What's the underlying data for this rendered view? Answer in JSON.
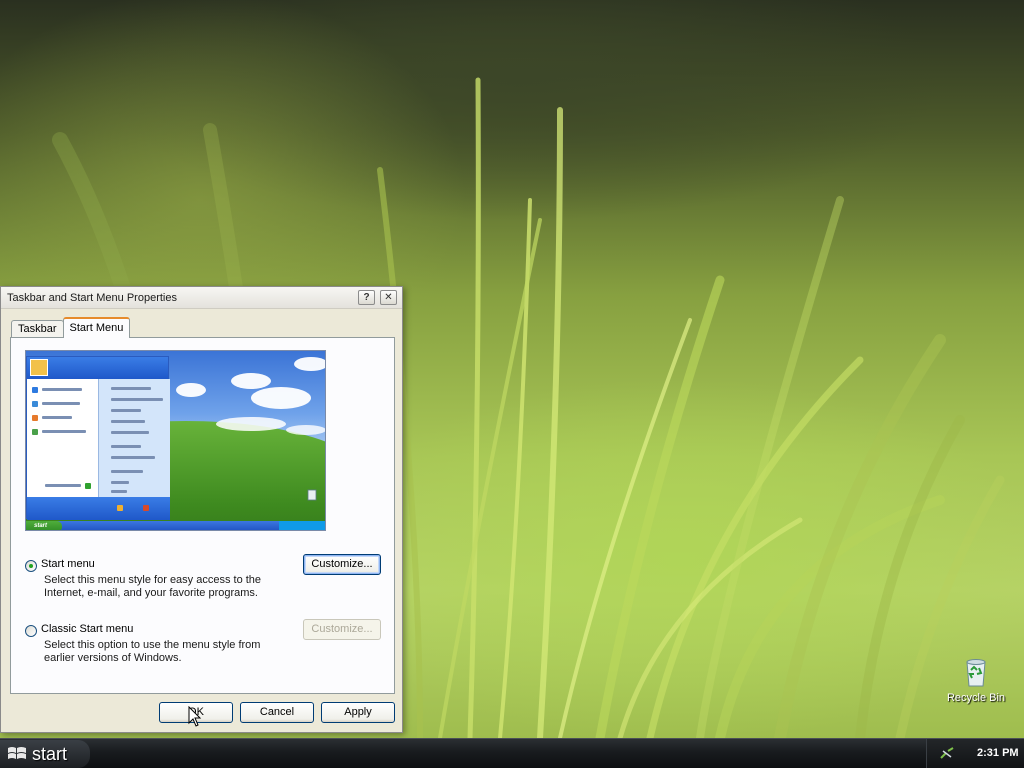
{
  "desktop": {
    "icons": [
      {
        "label": "Recycle Bin",
        "icon": "recycle-bin-icon"
      }
    ]
  },
  "window": {
    "title": "Taskbar and Start Menu Properties",
    "help_glyph": "?",
    "close_glyph": "✕",
    "tabs": [
      {
        "label": "Taskbar",
        "active": false
      },
      {
        "label": "Start Menu",
        "active": true
      }
    ],
    "preview": {
      "start_label": "start"
    },
    "options": [
      {
        "label": "Start menu",
        "selected": true,
        "description": "Select this menu style for easy access to the Internet, e-mail, and your favorite programs.",
        "customize_label": "Customize...",
        "customize_enabled": true
      },
      {
        "label": "Classic Start menu",
        "selected": false,
        "description": "Select this option to use the menu style from earlier versions of Windows.",
        "customize_label": "Customize...",
        "customize_enabled": false
      }
    ],
    "buttons": {
      "ok": "OK",
      "cancel": "Cancel",
      "apply": "Apply"
    }
  },
  "taskbar": {
    "start_label": "start",
    "clock": "2:31 PM"
  },
  "colors": {
    "tab_accent": "#e68b2c",
    "button_border": "#003c74",
    "radio_selected": "#21a121"
  }
}
